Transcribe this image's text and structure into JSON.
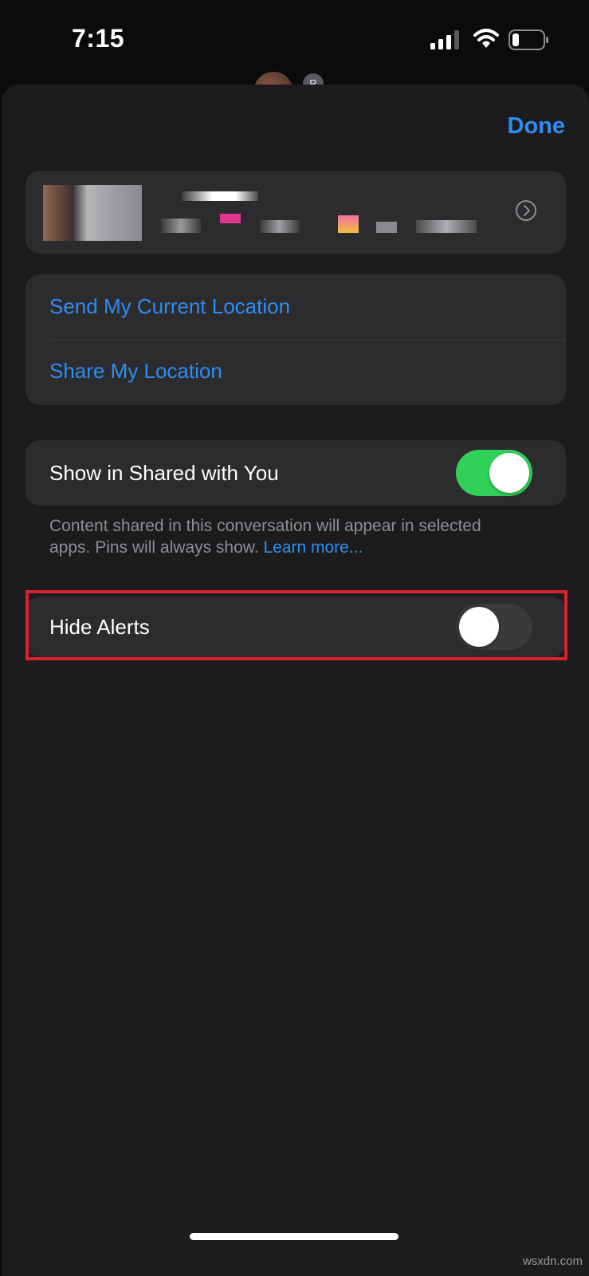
{
  "status_bar": {
    "time": "7:15",
    "icons": [
      "cellular-signal-icon",
      "wifi-icon",
      "battery-icon"
    ]
  },
  "header": {
    "avatar_badge": "R",
    "done_label": "Done"
  },
  "contact": {
    "icon": "chevron-right-circle-icon"
  },
  "location": {
    "send_current": "Send My Current Location",
    "share": "Share My Location"
  },
  "shared_with_you": {
    "label": "Show in Shared with You",
    "enabled": true,
    "note": "Content shared in this conversation will appear in selected apps. Pins will always show.",
    "learn_more": "Learn more..."
  },
  "alerts": {
    "label": "Hide Alerts",
    "enabled": false
  },
  "colors": {
    "accent": "#2f8cf2",
    "toggle_on": "#30d158",
    "toggle_off": "#3a3a3c",
    "highlight": "#d9232d"
  },
  "watermark": "wsxdn.com"
}
